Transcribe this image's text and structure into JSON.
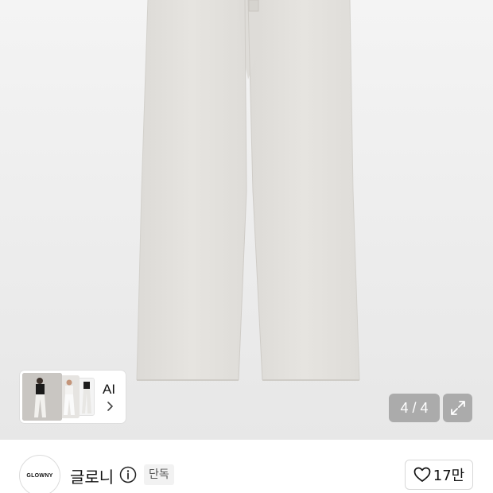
{
  "gallery": {
    "counter_text": "4 / 4",
    "ai_label": "AI",
    "expand_icon": "expand-icon",
    "chevron_icon": "chevron-right-icon"
  },
  "brand": {
    "logo_text": "GLOWNY",
    "name": "글로니",
    "info_icon": "info-icon",
    "badge": "단독"
  },
  "like": {
    "icon": "heart-icon",
    "count": "17만"
  },
  "colors": {
    "pants": "#e4e2de",
    "overlay": "#a0a0a0",
    "background": "#ececec"
  }
}
